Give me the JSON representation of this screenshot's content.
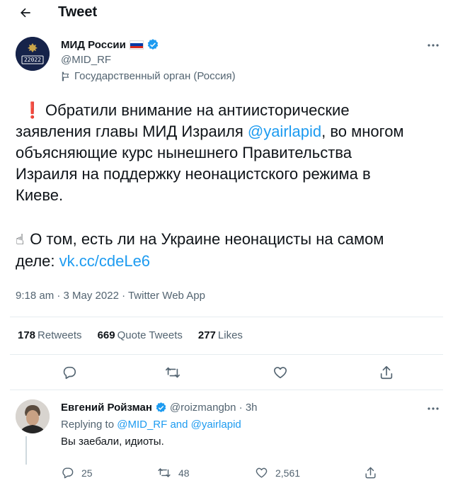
{
  "header": {
    "title": "Tweet"
  },
  "tweet": {
    "author_name": "МИД России",
    "author_handle": "@MID_RF",
    "org_label": "Государственный орган (Россия)",
    "avatar_text": "22022",
    "para1_line1": "Обратили внимание на антиисторические",
    "para1_line2_pre": "заявления главы МИД Израиля ",
    "mention": "@yairlapid",
    "para1_line2_post": ", во многом",
    "para1_line3": "объясняющие курс нынешнего Правительства",
    "para1_line4": "Израиля на поддержку неонацистского режима в",
    "para1_line5": "Киеве.",
    "para2_line1": "О том, есть ли на Украине неонацисты на самом",
    "para2_line2_pre": "деле: ",
    "link": "vk.cc/cdeLe6",
    "timestamp": "9:18 am · 3 May 2022 · Twitter Web App",
    "stats": {
      "retweets_count": "178",
      "retweets_label": "Retweets",
      "quotes_count": "669",
      "quotes_label": "Quote Tweets",
      "likes_count": "277",
      "likes_label": "Likes"
    }
  },
  "reply": {
    "author_name": "Евгений Ройзман",
    "author_handle": "@roizmangbn · 3h",
    "replying_prefix": "Replying to ",
    "replying_to_1": "@MID_RF",
    "replying_and": " and ",
    "replying_to_2": "@yairlapid",
    "text": "Вы заебали, идиоты.",
    "reply_count": "25",
    "retweet_count": "48",
    "like_count": "2,561"
  },
  "colors": {
    "accent": "#1d9bf0",
    "text": "#0f1419",
    "secondary": "#536471",
    "verified": "#1d9bf0",
    "flag_white": "#ffffff",
    "flag_blue": "#0039a6",
    "flag_red": "#d52b1e"
  },
  "icons": [
    "back-arrow-icon",
    "verified-badge-icon",
    "flag-icon",
    "more-icon",
    "reply-icon",
    "retweet-icon",
    "like-icon",
    "share-icon",
    "exclamation-icon",
    "pointing-hand-icon"
  ]
}
